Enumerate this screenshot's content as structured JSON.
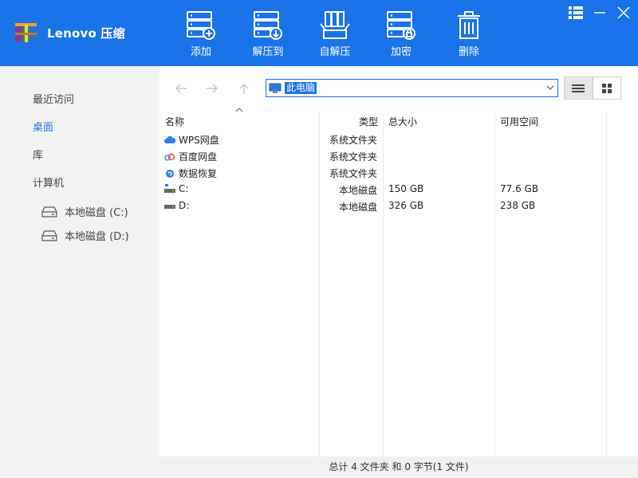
{
  "app": {
    "title": "Lenovo 压缩"
  },
  "toolbar": {
    "add": "添加",
    "extract_to": "解压到",
    "self_extract": "自解压",
    "encrypt": "加密",
    "delete": "删除"
  },
  "sidebar": {
    "recent": "最近访问",
    "desktop": "桌面",
    "library": "库",
    "computer": "计算机",
    "drive_c": "本地磁盘 (C:)",
    "drive_d": "本地磁盘 (D:)"
  },
  "address": {
    "path": "此电脑"
  },
  "columns": {
    "name": "名称",
    "type": "类型",
    "total": "总大小",
    "free": "可用空间"
  },
  "rows": [
    {
      "name": "WPS网盘",
      "type": "系统文件夹",
      "total": "",
      "free": "",
      "icon": "cloud-icon"
    },
    {
      "name": "百度网盘",
      "type": "系统文件夹",
      "total": "",
      "free": "",
      "icon": "baidu-cloud-icon"
    },
    {
      "name": "数据恢复",
      "type": "系统文件夹",
      "total": "",
      "free": "",
      "icon": "data-recovery-icon"
    },
    {
      "name": "C:",
      "type": "本地磁盘",
      "total": "150 GB",
      "free": "77.6 GB",
      "icon": "drive-c-icon"
    },
    {
      "name": "D:",
      "type": "本地磁盘",
      "total": "326 GB",
      "free": "238 GB",
      "icon": "drive-icon"
    }
  ],
  "status": {
    "text": "总计 4 文件夹 和  0 字节(1 文件)"
  },
  "colors": {
    "accent": "#1a73e8",
    "sidebar_bg": "#f2f2f2"
  }
}
